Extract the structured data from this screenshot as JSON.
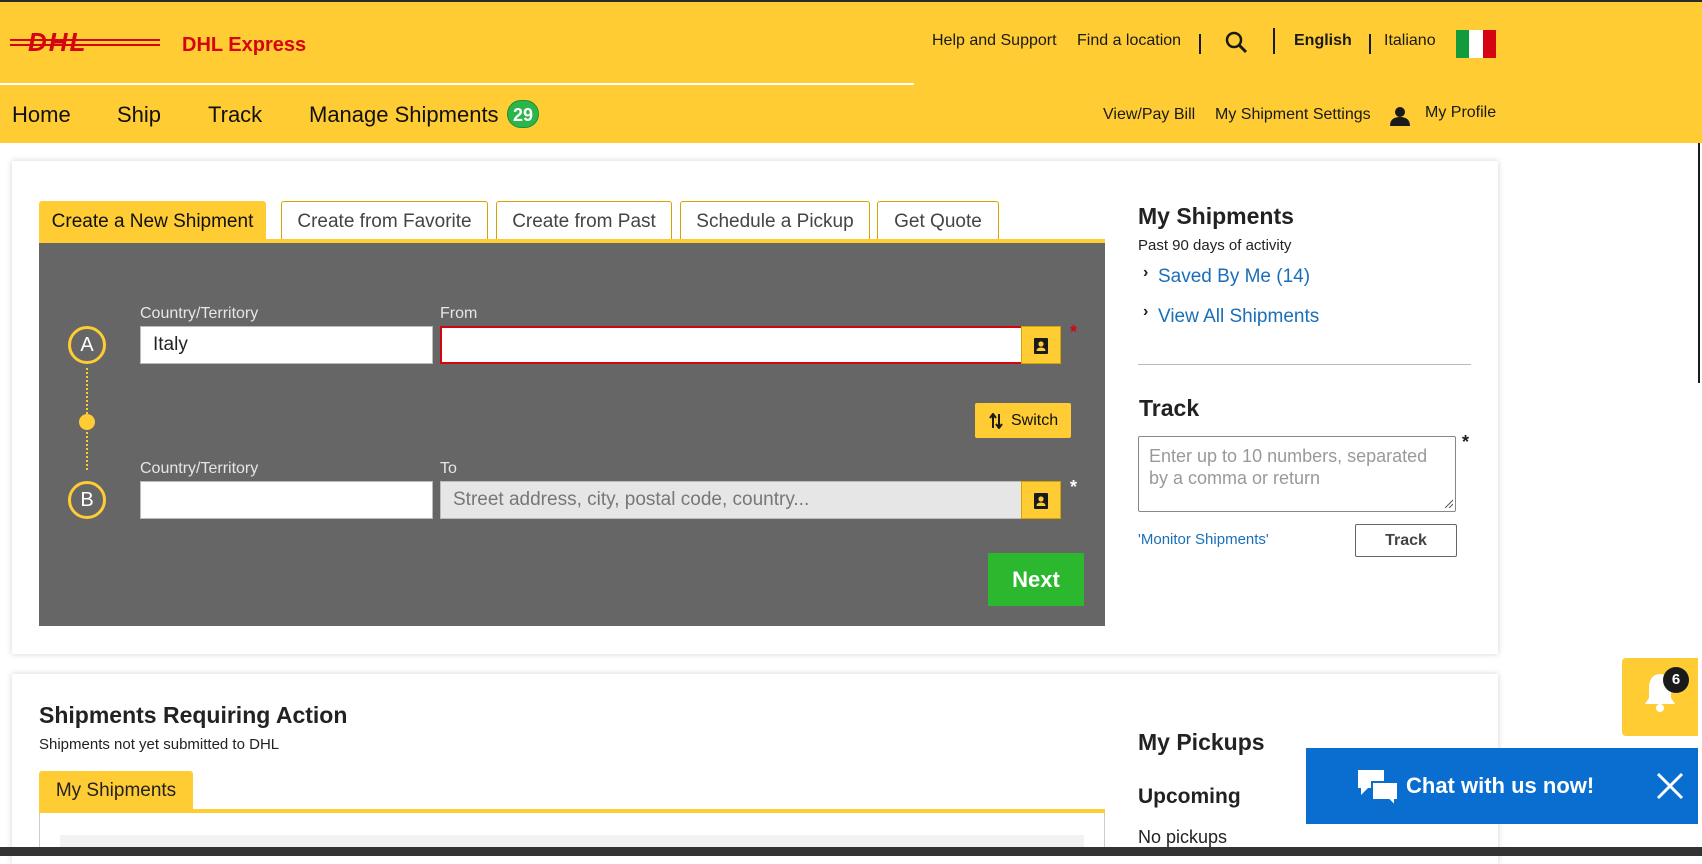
{
  "brand": {
    "logo_alt": "DHL",
    "product": "DHL Express",
    "logo_color": "#d40511",
    "accent": "#ffcc33"
  },
  "utility_nav": {
    "help": "Help and Support",
    "find_location": "Find a location",
    "search_icon": "search-icon",
    "lang_current": "English",
    "lang_other": "Italiano",
    "flag": "italy-flag-icon"
  },
  "main_nav": {
    "home": "Home",
    "ship": "Ship",
    "track": "Track",
    "manage": "Manage Shipments",
    "manage_count": "29"
  },
  "sub_nav": {
    "pay_bill": "View/Pay Bill",
    "settings": "My Shipment Settings",
    "profile": "My Profile"
  },
  "shipment_tabs": [
    {
      "label": "Create a New Shipment",
      "active": true
    },
    {
      "label": "Create from Favorite",
      "active": false
    },
    {
      "label": "Create from Past",
      "active": false
    },
    {
      "label": "Schedule a Pickup",
      "active": false
    },
    {
      "label": "Get Quote",
      "active": false
    }
  ],
  "form": {
    "origin_marker": "A",
    "dest_marker": "B",
    "country_label": "Country/Territory",
    "from_label": "From",
    "to_label": "To",
    "origin_country": "Italy",
    "from_value": "",
    "dest_country": "",
    "to_placeholder": "Street address, city, postal code, country...",
    "required_mark": "*",
    "switch_label": "Switch",
    "next_label": "Next"
  },
  "my_shipments": {
    "title": "My Shipments",
    "subtitle": "Past 90 days of activity",
    "saved_link": "Saved By Me (14)",
    "view_all_link": "View All Shipments"
  },
  "track": {
    "title": "Track",
    "placeholder": "Enter up to 10 numbers, separated by a comma or return",
    "required_mark": "*",
    "monitor_link": "'Monitor Shipments'",
    "button": "Track"
  },
  "requiring_action": {
    "title": "Shipments Requiring Action",
    "subtitle": "Shipments not yet submitted to DHL",
    "tab": "My Shipments"
  },
  "pickups": {
    "title": "My Pickups",
    "upcoming": "Upcoming",
    "empty": "No pickups"
  },
  "notifications": {
    "count": "6"
  },
  "chat": {
    "label": "Chat with us now!"
  }
}
